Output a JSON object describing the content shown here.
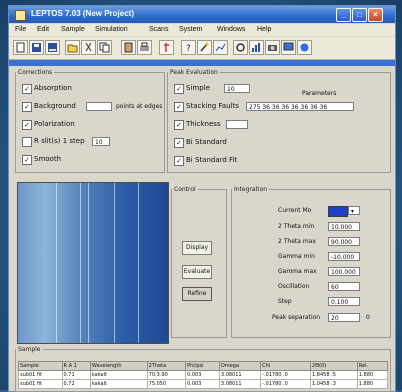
{
  "window": {
    "title": "LEPTOS 7.03 (New Project)"
  },
  "window_controls": {
    "minimize": "_",
    "maximize": "□",
    "close": "×"
  },
  "menu": [
    "File",
    "Edit",
    "Sample",
    "Simulation",
    "Scans",
    "System",
    "Windows",
    "Help"
  ],
  "toolbar_icons": [
    "new-file-icon",
    "save-icon",
    "save-all-icon",
    "open-icon",
    "cut-icon",
    "copy-icon",
    "paste-icon",
    "print-icon",
    "pin-icon",
    "help-icon",
    "wizard-icon",
    "chart-icon",
    "settings-icon",
    "graph-icon",
    "camera-icon",
    "monitor-icon",
    "info-icon"
  ],
  "corrections": {
    "legend": "Corrections",
    "items": [
      {
        "label": "Absorption",
        "checked": true
      },
      {
        "label": "Background",
        "checked": true,
        "field": "",
        "suffix": "points at edges"
      },
      {
        "label": "Polarization",
        "checked": true
      },
      {
        "label": "R slit(s) 1 step",
        "checked": false,
        "field": "10"
      },
      {
        "label": "Smooth",
        "checked": true
      }
    ]
  },
  "peak_evaluation": {
    "legend": "Peak Evaluation",
    "items": [
      {
        "label": "Simple",
        "checked": true,
        "dropdown": "10"
      },
      {
        "label": "Stacking Faults",
        "checked": true,
        "field": "275 36 36 36 36 36 36 36"
      },
      {
        "label": "Thickness",
        "checked": true,
        "field": ""
      },
      {
        "label": "Bi Standard",
        "checked": true
      },
      {
        "label": "Bi Standard Fit",
        "checked": true
      }
    ],
    "param_label": "Parameters"
  },
  "control": {
    "legend": "Control",
    "buttons": [
      "Display",
      "Evaluate",
      "Refine"
    ]
  },
  "integration": {
    "legend": "Integration",
    "fields": [
      {
        "label": "Current Mo",
        "value": "",
        "type": "color-dropdown"
      },
      {
        "label": "2 Theta min",
        "value": "10.000"
      },
      {
        "label": "2 Theta max",
        "value": "90.000"
      },
      {
        "label": "Gamma min",
        "value": "-10.000"
      },
      {
        "label": "Gamma max",
        "value": "100.000"
      },
      {
        "label": "Oscillation",
        "value": "60"
      },
      {
        "label": "Step",
        "value": "0.100"
      },
      {
        "label": "Peak separation",
        "value": "20"
      }
    ],
    "peak_sep_unit": "0"
  },
  "samples": {
    "legend": "Sample",
    "columns": [
      "Sample",
      "R A 1",
      "Wavelength",
      "2Theta",
      "Phi/psi",
      "Omega",
      "Chi",
      "2Θ(0)",
      "Rel."
    ],
    "rows": [
      [
        "sub01 fit",
        "0.71",
        "kakalt",
        "70.3.90",
        "0.003",
        "3.08011",
        "-.01780 .0",
        "1.8458 .5",
        "1.880"
      ],
      [
        "sub01 fit",
        "0.72",
        "kakalt",
        "75.050",
        "0.003",
        "3.08011",
        "-.01780 .0",
        "1.0458 .3",
        "1.880"
      ]
    ]
  },
  "colors": {
    "titlebar": "#2d6ccf",
    "window_bg": "#d9d6cc",
    "accent": "#1e3fc9"
  }
}
